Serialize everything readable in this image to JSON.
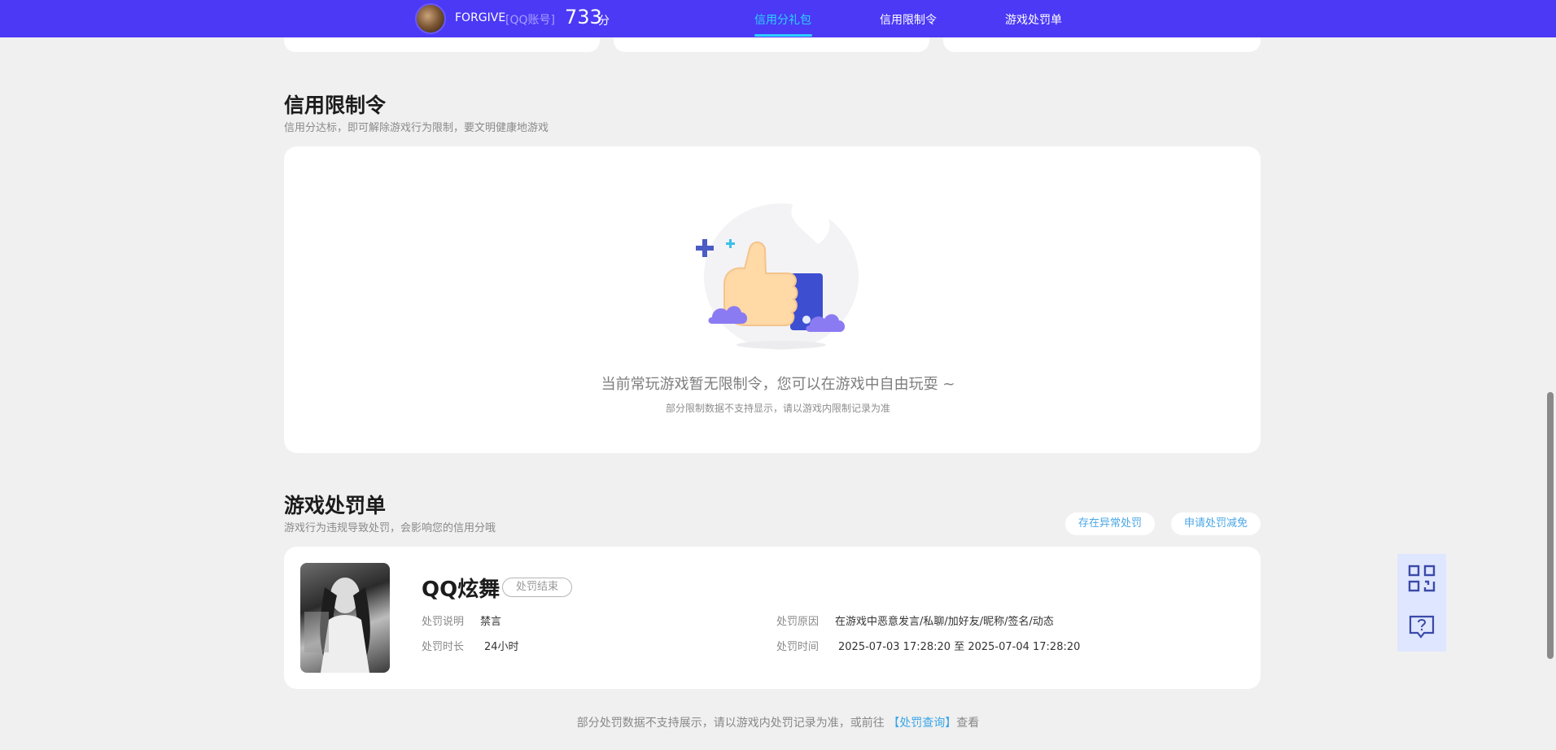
{
  "header": {
    "username": "FORGIVE",
    "account_tag": "[QQ账号]",
    "score": "733",
    "score_unit": "分",
    "tabs": [
      {
        "label": "信用分礼包",
        "active": true
      },
      {
        "label": "信用限制令",
        "active": false
      },
      {
        "label": "游戏处罚单",
        "active": false
      }
    ],
    "colors": {
      "bar": "#4b39f6",
      "active_tab": "#2cd2ff"
    }
  },
  "restriction": {
    "title": "信用限制令",
    "subtitle": "信用分达标，即可解除游戏行为限制，要文明健康地游戏",
    "empty_text": "当前常玩游戏暂无限制令，您可以在游戏中自由玩耍 ~",
    "empty_sub": "部分限制数据不支持显示，请以游戏内限制记录为准",
    "illustration_icon": "thumbs-up-icon"
  },
  "penalty": {
    "title": "游戏处罚单",
    "subtitle": "游戏行为违规导致处罚，会影响您的信用分哦",
    "btn_abnormal": "存在异常处罚",
    "btn_appeal": "申请处罚减免",
    "record": {
      "game": "QQ炫舞",
      "status": "处罚结束",
      "desc_label": "处罚说明",
      "desc_value": "禁言",
      "duration_label": "处罚时长",
      "duration_value": "24小时",
      "reason_label": "处罚原因",
      "reason_value": "在游戏中恶意发言/私聊/加好友/昵称/签名/动态",
      "time_label": "处罚时间",
      "time_value": "2025-07-03 17:28:20 至 2025-07-04 17:28:20"
    }
  },
  "footer": {
    "note_prefix": "部分处罚数据不支持展示，请以游戏内处罚记录为准，或前往",
    "link": "【处罚查询】",
    "note_suffix": "查看"
  },
  "side_tools": {
    "qr_icon": "qr-code-icon",
    "help_icon": "help-chat-icon"
  }
}
